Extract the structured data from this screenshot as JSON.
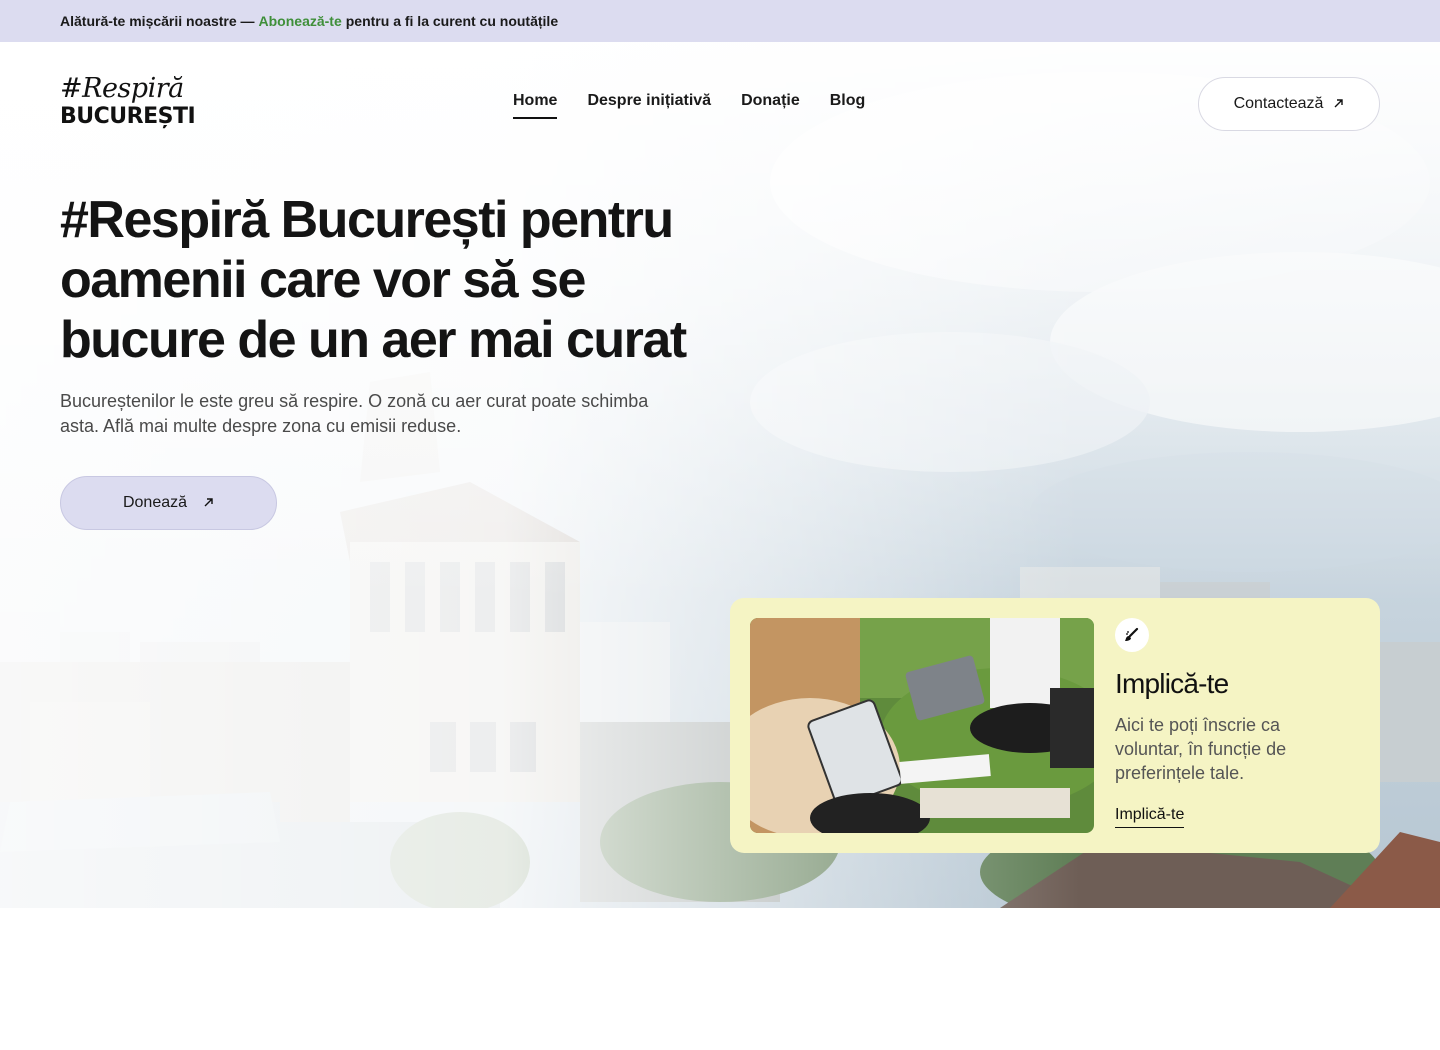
{
  "announcement": {
    "prefix": "Alătură-te mișcării noastre —",
    "link": "Abonează-te",
    "suffix": "pentru a fi la curent cu noutățile"
  },
  "logo": {
    "script": "#Respiră",
    "block": "BUCUREȘTI"
  },
  "nav": {
    "items": [
      {
        "label": "Home",
        "active": true
      },
      {
        "label": "Despre inițiativă"
      },
      {
        "label": "Donație"
      },
      {
        "label": "Blog"
      }
    ]
  },
  "header": {
    "contact_label": "Contactează",
    "contact_icon": "arrow-up-right-icon"
  },
  "hero": {
    "headline": "#Respiră București pentru oamenii care vor să se bucure de un aer mai curat",
    "lead": "Bucureștenilor le este greu să respire. O zonă cu aer curat poate schimba asta. Află mai multe despre zona cu emisii reduse.",
    "donate_label": "Donează",
    "donate_icon": "arrow-up-right-icon"
  },
  "card": {
    "icon": "brush-icon",
    "title": "Implică-te",
    "description": "Aici te poți înscrie ca voluntar, în funcție de preferințele tale.",
    "link_label": "Implică-te"
  },
  "colors": {
    "topbar_bg": "#dcdcf0",
    "link_green": "#3f8f3a",
    "card_bg": "#f5f4c4",
    "donate_bg": "#dcdcf0"
  }
}
